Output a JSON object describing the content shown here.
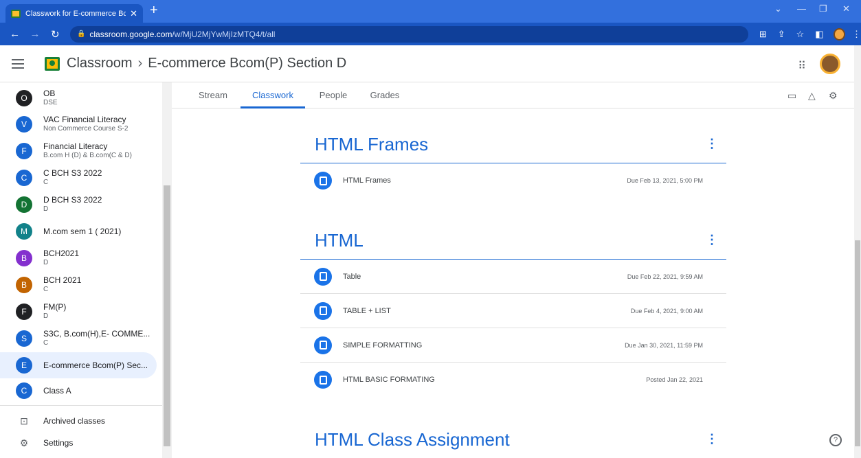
{
  "browser": {
    "tab_title": "Classwork for E-commerce Bcom",
    "url_host": "classroom.google.com",
    "url_path": "/w/MjU2MjYwMjIzMTQ4/t/all"
  },
  "header": {
    "app_name": "Classroom",
    "separator": "›",
    "class_name": "E-commerce Bcom(P) Section D"
  },
  "sidebar": {
    "classes": [
      {
        "letter": "O",
        "name": "OB",
        "sub": "DSE",
        "color": "#202124"
      },
      {
        "letter": "V",
        "name": "VAC Financial Literacy",
        "sub": "Non Commerce Course S-2",
        "color": "#1967d2"
      },
      {
        "letter": "F",
        "name": "Financial Literacy",
        "sub": "B.com H (D) & B.com(C & D)",
        "color": "#1967d2"
      },
      {
        "letter": "C",
        "name": "C BCH S3 2022",
        "sub": "C",
        "color": "#1967d2"
      },
      {
        "letter": "D",
        "name": "D BCH S3 2022",
        "sub": "D",
        "color": "#137333"
      },
      {
        "letter": "M",
        "name": "M.com sem 1 ( 2021)",
        "sub": "",
        "color": "#12828a"
      },
      {
        "letter": "B",
        "name": "BCH2021",
        "sub": "D",
        "color": "#8430ce"
      },
      {
        "letter": "B",
        "name": "BCH 2021",
        "sub": "C",
        "color": "#c26401"
      },
      {
        "letter": "F",
        "name": "FM(P)",
        "sub": "D",
        "color": "#202124"
      },
      {
        "letter": "S",
        "name": "S3C, B.com(H),E- COMME...",
        "sub": "C",
        "color": "#1967d2"
      },
      {
        "letter": "E",
        "name": "E-commerce Bcom(P) Sec...",
        "sub": "",
        "color": "#1967d2"
      },
      {
        "letter": "C",
        "name": "Class A",
        "sub": "",
        "color": "#1967d2"
      }
    ],
    "archived_label": "Archived classes",
    "settings_label": "Settings"
  },
  "tabs": [
    "Stream",
    "Classwork",
    "People",
    "Grades"
  ],
  "topics": [
    {
      "title": "HTML Frames",
      "items": [
        {
          "title": "HTML Frames",
          "due": "Due Feb 13, 2021, 5:00 PM"
        }
      ]
    },
    {
      "title": "HTML",
      "items": [
        {
          "title": "Table",
          "due": "Due Feb 22, 2021, 9:59 AM"
        },
        {
          "title": "TABLE + LIST",
          "due": "Due Feb 4, 2021, 9:00 AM"
        },
        {
          "title": "SIMPLE FORMATTING",
          "due": "Due Jan 30, 2021, 11:59 PM"
        },
        {
          "title": "HTML BASIC FORMATING",
          "due": "Posted Jan 22, 2021"
        }
      ]
    },
    {
      "title": "HTML Class Assignment",
      "items": []
    }
  ],
  "icons": {
    "menu": "hamburger-icon",
    "apps": "apps-grid-icon",
    "calendar": "calendar-icon",
    "drive": "drive-icon",
    "settings": "gear-icon",
    "help": "help-icon",
    "assignment": "assignment-icon"
  },
  "help_glyph": "?",
  "more_glyph": "⋮"
}
